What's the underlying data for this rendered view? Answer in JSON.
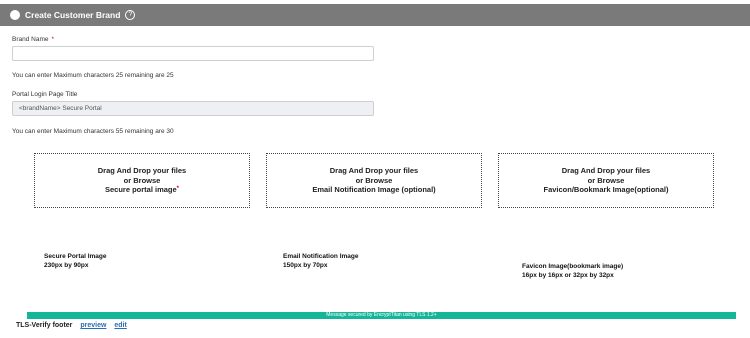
{
  "header": {
    "title": "Create Customer Brand",
    "help_glyph": "?"
  },
  "brand_name": {
    "label": "Brand Name",
    "required_mark": "*",
    "value": "",
    "helper": "You can enter Maximum characters 25 remaining are 25"
  },
  "portal_title": {
    "label": "Portal Login Page Title",
    "value": "<brandName> Secure Portal",
    "helper": "You can enter Maximum characters 55 remaining are 30"
  },
  "dropzones": [
    {
      "line1": "Drag And Drop your files",
      "line2": "or Browse",
      "line3": "Secure portal image",
      "required_mark": "*"
    },
    {
      "line1": "Drag And Drop your files",
      "line2": "or Browse",
      "line3": "Email Notification Image (optional)"
    },
    {
      "line1": "Drag And Drop your files",
      "line2": "or Browse",
      "line3": "Favicon/Bookmark Image(optional)"
    }
  ],
  "specs": [
    {
      "title": "Secure Portal Image",
      "size": "230px by 90px"
    },
    {
      "title": "Email Notification Image",
      "size": "150px by 70px"
    },
    {
      "title": "Favicon Image(bookmark image)",
      "size": "16px by 16px or 32px by 32px"
    }
  ],
  "footer": {
    "bar_text": "Message secured by EncryptTitan using TLS 1.2+",
    "label": "TLS-Verify footer",
    "preview_link": "preview",
    "edit_link": "edit"
  },
  "colors": {
    "header_bg": "#7a7a7a",
    "footer_bar": "#15b59a",
    "link": "#2a6fb0",
    "required": "#d0021b"
  }
}
